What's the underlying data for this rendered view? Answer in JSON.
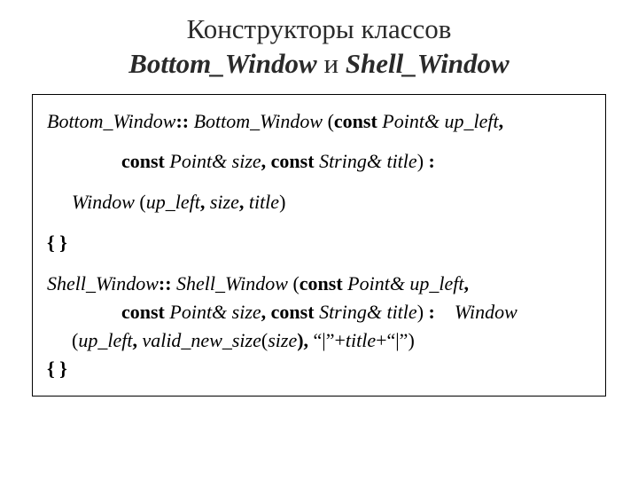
{
  "title": {
    "line1": "Конструкторы классов",
    "line2_a": "Bottom_Window",
    "line2_and": "  и ",
    "line2_b": "Shell_Window"
  },
  "code": {
    "l1_a": "Bottom_Window",
    "l1_b": ":: ",
    "l1_c": "Bottom_Window ",
    "l1_d": "(",
    "l1_e": "const",
    "l1_f": " Point& up_left",
    "l1_g": ",",
    "l2_a": "const",
    "l2_b": " Point& size",
    "l2_c": ", ",
    "l2_d": "const",
    "l2_e": " String& title",
    "l2_f": ") ",
    "l2_g": ":",
    "l3_a": "Window ",
    "l3_b": "(",
    "l3_c": "up_left",
    "l3_d": ", ",
    "l3_e": "size",
    "l3_f": ", ",
    "l3_g": "title",
    "l3_h": ")",
    "l4": "{ }",
    "l5_a": "Shell_Window",
    "l5_b": ":: ",
    "l5_c": "Shell_Window ",
    "l5_d": "(",
    "l5_e": "const",
    "l5_f": " Point& up_left",
    "l5_g": ",",
    "l6_a": "const",
    "l6_b": " Point& size",
    "l6_c": ", ",
    "l6_d": "const",
    "l6_e": " String& title",
    "l6_f": ") ",
    "l6_g": ":",
    "l6_h": "    ",
    "l6_i": "Window",
    "l7_a": "(",
    "l7_b": "up_left",
    "l7_c": ", ",
    "l7_d": "valid_new_size",
    "l7_e": "(",
    "l7_f": "size",
    "l7_g": "), ",
    "l7_h": "“|”+",
    "l7_i": "title",
    "l7_j": "+“|”",
    "l7_k": ")",
    "l8": "{ }"
  }
}
